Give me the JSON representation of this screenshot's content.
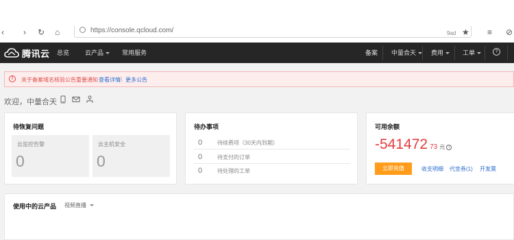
{
  "browser": {
    "url": "https://console.qcloud.com/",
    "right_hint": "9ad"
  },
  "brand": {
    "name": "腾讯云",
    "logo_icon": "cloud-logo-icon"
  },
  "nav": {
    "overview": "总览",
    "products": "云产品",
    "services": "常用服务",
    "bundle": "备案",
    "account": "中量合天",
    "billing": "费用",
    "tickets": "工单",
    "help_icon": "help-icon"
  },
  "notice": {
    "text": "关于备案域名核验公告重要通知",
    "detail_link": "查看详情",
    "separator": "|",
    "more_link": "更多公告"
  },
  "welcome": {
    "text": "欢迎，中量合天"
  },
  "pending_recovery": {
    "title": "待恢复问题",
    "tiles": [
      {
        "label": "云监控告警",
        "value": "0"
      },
      {
        "label": "云主机安全",
        "value": "0"
      }
    ]
  },
  "todo": {
    "title": "待办事项",
    "rows": [
      {
        "count": "0",
        "label": "待续费项（30天内到期）"
      },
      {
        "count": "0",
        "label": "待支付的订单"
      },
      {
        "count": "0",
        "label": "待处理的工单"
      }
    ]
  },
  "balance": {
    "title": "可用余额",
    "amount": "-541472",
    "decimal": "73",
    "unit": "元",
    "info_icon": "i",
    "recharge": "立即充值",
    "links": [
      "收支明细",
      "代金券(1)",
      "开发票"
    ]
  },
  "products": {
    "title": "使用中的云产品",
    "selected": "视频直播"
  }
}
